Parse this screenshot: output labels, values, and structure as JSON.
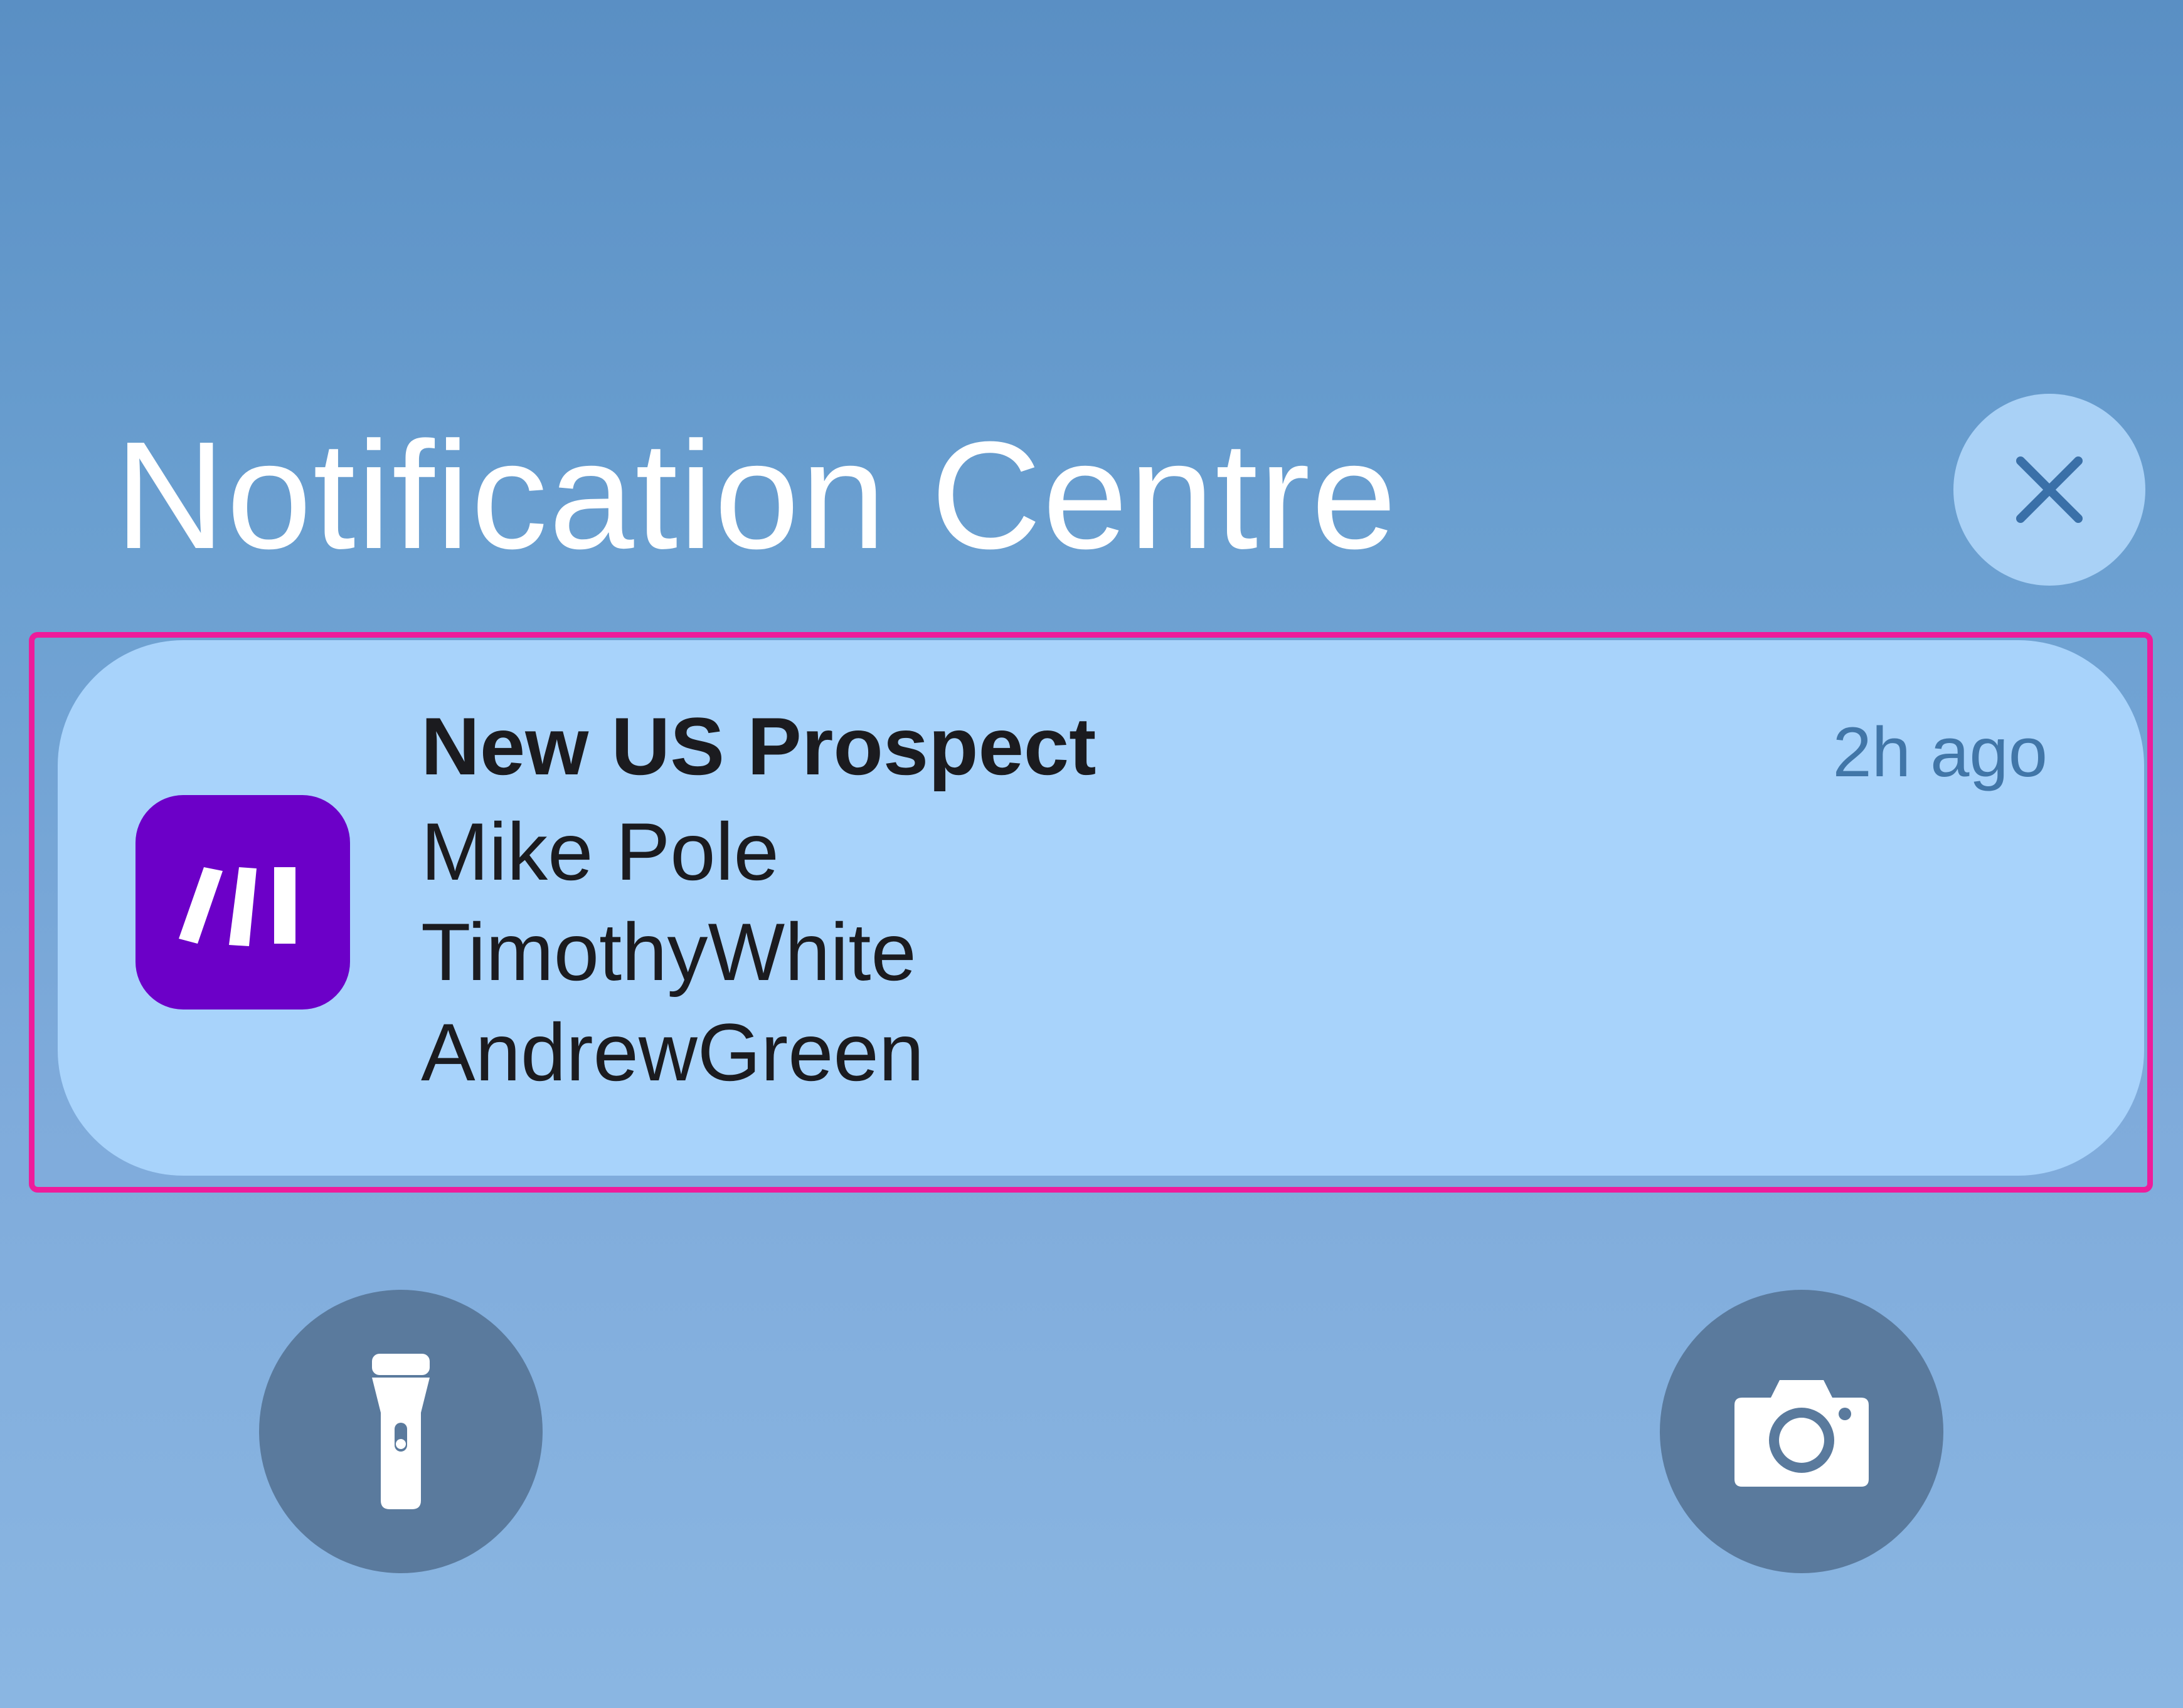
{
  "header": {
    "title": "Notification Centre",
    "close_icon": "close-icon"
  },
  "notification": {
    "app_icon": "make-app-icon",
    "app_icon_color": "#6c00c8",
    "title": "New US Prospect",
    "time": "2h ago",
    "lines": [
      "Mike Pole",
      "TimothyWhite",
      "AndrewGreen"
    ],
    "highlight_color": "#ee1c9b"
  },
  "quick_actions": {
    "left": "flashlight-icon",
    "right": "camera-icon"
  }
}
